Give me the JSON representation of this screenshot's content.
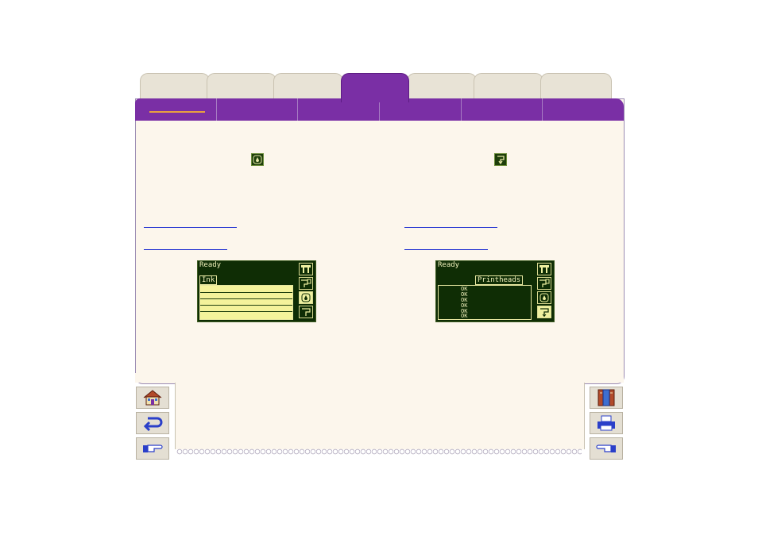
{
  "tabs": [
    {
      "id": "tab-1",
      "label": "",
      "active": false
    },
    {
      "id": "tab-2",
      "label": "",
      "active": false
    },
    {
      "id": "tab-3",
      "label": "",
      "active": false
    },
    {
      "id": "tab-4",
      "label": "",
      "active": true
    },
    {
      "id": "tab-5",
      "label": "",
      "active": false
    },
    {
      "id": "tab-6",
      "label": "",
      "active": false
    },
    {
      "id": "tab-7",
      "label": "",
      "active": false
    }
  ],
  "subnav": {
    "items": [
      "",
      "",
      "",
      "",
      "",
      ""
    ],
    "active_index": 0,
    "active_underline_color": "#e8a040"
  },
  "left_column": {
    "icon": "ink-drop-icon",
    "links": [
      "",
      ""
    ],
    "lcd": {
      "status": "Ready",
      "tab_label": "Ink",
      "side_icons": [
        "printer-icon",
        "printhead-icon",
        "ink-drop-icon",
        "printhead-arrow-icon"
      ],
      "selected_side_index": 2
    }
  },
  "right_column": {
    "icon": "printhead-arrow-icon",
    "links": [
      "",
      ""
    ],
    "lcd": {
      "status": "Ready",
      "tab_label": "Printheads",
      "rows": [
        "OK",
        "OK",
        "OK",
        "OK",
        "OK",
        "OK"
      ],
      "side_icons": [
        "printer-icon",
        "printhead-icon",
        "ink-drop-icon",
        "printhead-arrow-icon"
      ],
      "selected_side_index": 3
    }
  },
  "nav_left": [
    "home-icon",
    "back-arrow-icon",
    "pointing-hand-right-icon"
  ],
  "nav_right": [
    "book-contents-icon",
    "print-icon",
    "pointing-hand-left-icon"
  ],
  "colors": {
    "tab_active": "#7a2fa5",
    "panel_bg": "#fcf6ec",
    "lcd_bg": "#0f2d05",
    "lcd_fg": "#f3f3bd",
    "link": "#1a2bd0"
  }
}
